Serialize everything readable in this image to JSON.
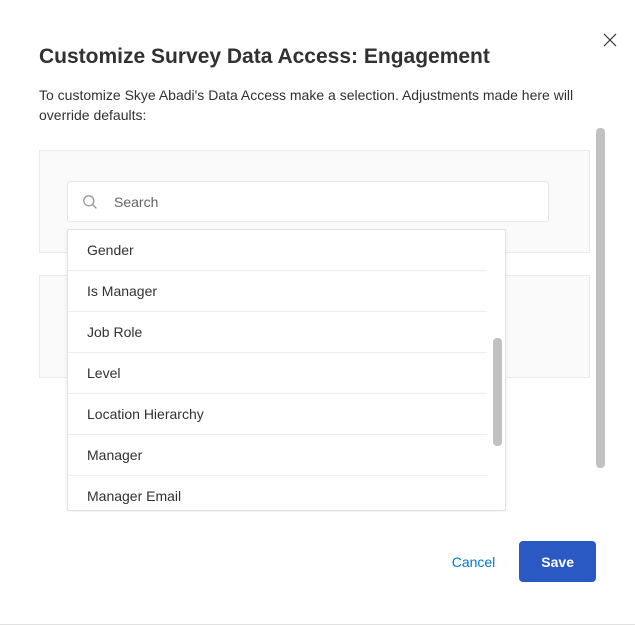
{
  "header": {
    "title": "Customize Survey Data Access: Engagement",
    "description": "To customize Skye Abadi's Data Access make a selection. Adjustments made here will override defaults:"
  },
  "search": {
    "placeholder": "Search",
    "value": ""
  },
  "dropdown": {
    "items": [
      "Gender",
      "Is Manager",
      "Job Role",
      "Level",
      "Location Hierarchy",
      "Manager",
      "Manager Email"
    ]
  },
  "footer": {
    "cancel_label": "Cancel",
    "save_label": "Save"
  }
}
